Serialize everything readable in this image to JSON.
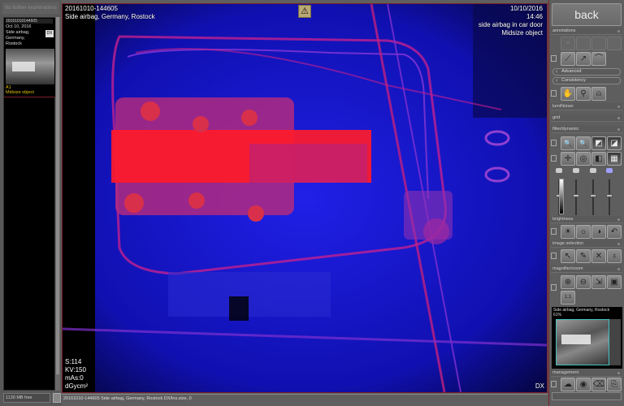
{
  "left_panel": {
    "title": "No further examinations",
    "thumbnail": {
      "id": "20161010144605",
      "meta": "Oct 10, 2016\nSide airbag,\nGermany,\nRostock",
      "badge": "DX",
      "caption": "A1\nMidsize object"
    },
    "free_space": "1130 MB free"
  },
  "viewer": {
    "overlay_top_left": "20161010-144605\nSide airbag, Germany, Rostock",
    "overlay_top_right": "10/10/2016\n14:46\nside airbag in car door\nMidsize object",
    "overlay_bottom_left": "S:114\nKV:150\nmAs:0\ndGycm²",
    "overlay_bottom_right": "DX",
    "warning_icon": "warning-triangle-icon",
    "warning_glyph": "⚠",
    "colors": {
      "high_density": "#ff1a2a",
      "low_density": "#1a1aff",
      "background": "#000000"
    }
  },
  "status_bar": "20161010-144605  Side airbag, Germany, Rostock DX/Ins.size, 0",
  "right_panel": {
    "back_label": "back",
    "sections": {
      "annotations": "annotations",
      "advanced": "Advanced",
      "consistency": "Consistency",
      "lumiNoiser": "lumiNoiser",
      "grid": "grid",
      "filter_dynamic": "filter/dynamic",
      "brightness": "brightness",
      "image_selection": "image selection",
      "magnifier_zoom": "magnifier/zoom",
      "management": "management"
    },
    "annotation_tools": [
      {
        "name": "point-icon",
        "glyph": "•"
      },
      {
        "name": "blank-tool-icon",
        "glyph": ""
      },
      {
        "name": "blank-tool-icon",
        "glyph": ""
      },
      {
        "name": "blank-tool-icon",
        "glyph": ""
      },
      {
        "name": "measure-line-icon",
        "glyph": "⟋"
      },
      {
        "name": "arrow-line-icon",
        "glyph": "↗"
      },
      {
        "name": "arc-icon",
        "glyph": "⌒"
      }
    ],
    "consistency_tools": [
      {
        "name": "hand-icon",
        "glyph": "✋"
      },
      {
        "name": "body-icon",
        "glyph": "⚲"
      },
      {
        "name": "probe-icon",
        "glyph": "⍝"
      }
    ],
    "filter_tools": [
      {
        "name": "magnify-filter-icon",
        "glyph": "🔍"
      },
      {
        "name": "magnify-filter-2-icon",
        "glyph": "🔍"
      },
      {
        "name": "contrast-filter-icon",
        "glyph": "◩"
      },
      {
        "name": "edge-filter-icon",
        "glyph": "◪"
      },
      {
        "name": "crosshair-icon",
        "glyph": "✛"
      },
      {
        "name": "circle-filter-icon",
        "glyph": "◎"
      },
      {
        "name": "invert-icon",
        "glyph": "◧"
      },
      {
        "name": "grid-pattern-icon",
        "glyph": "▦"
      }
    ],
    "sliders": [
      {
        "name": "gamma-slider",
        "value": 0.55
      },
      {
        "name": "contrast-slider",
        "value": 0.55
      },
      {
        "name": "brightness-slider",
        "value": 0.55
      },
      {
        "name": "saturation-slider",
        "value": 0.55
      }
    ],
    "brightness_tools": [
      {
        "name": "brightness-up-icon",
        "glyph": "☀"
      },
      {
        "name": "brightness-down-icon",
        "glyph": "☼"
      },
      {
        "name": "color-mode-icon",
        "glyph": "◑"
      },
      {
        "name": "undo-icon",
        "glyph": "↶"
      }
    ],
    "selection_tools": [
      {
        "name": "pointer-icon",
        "glyph": "↖"
      },
      {
        "name": "pen-icon",
        "glyph": "✎"
      },
      {
        "name": "delete-icon",
        "glyph": "✕"
      },
      {
        "name": "apple-icon",
        "glyph": "♁"
      }
    ],
    "zoom_tools": [
      {
        "name": "zoom-in-icon",
        "glyph": "⊕"
      },
      {
        "name": "zoom-out-icon",
        "glyph": "⊖"
      },
      {
        "name": "zoom-fit-icon",
        "glyph": "⇲"
      },
      {
        "name": "fullscreen-icon",
        "glyph": "▣"
      },
      {
        "name": "zoom-1to1-icon",
        "glyph": "1:1"
      }
    ],
    "navigator": {
      "caption": "Side airbag, Germany, Rostock\n61%"
    },
    "management_tools": [
      {
        "name": "cloud-icon",
        "glyph": "☁"
      },
      {
        "name": "burn-disc-icon",
        "glyph": "◉"
      },
      {
        "name": "eraser-icon",
        "glyph": "⌫"
      },
      {
        "name": "export-icon",
        "glyph": "⎘"
      }
    ]
  }
}
